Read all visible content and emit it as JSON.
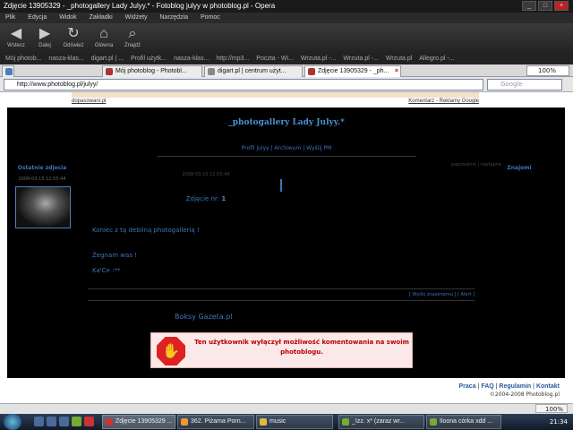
{
  "window": {
    "title": "Zdjęcie 13905329 - _photogallery Lady Julyy.* - Fotoblog julyy w photoblog.pl - Opera"
  },
  "menu": [
    "Plik",
    "Edycja",
    "Widok",
    "Zakładki",
    "Widżety",
    "Narzędzia",
    "Pomoc"
  ],
  "toolbar": {
    "back": "Wstecz",
    "forward": "Dalej",
    "reload": "Odśwież",
    "home": "Główna",
    "find": "Znajdź"
  },
  "bookmarks": [
    "Mój photob...",
    "nasza-klas...",
    "digart.pl | ...",
    "Profil użytk...",
    "nasza-klas...",
    "http://mp3...",
    "Poczta - Wi...",
    "Wrzuta.pl -...",
    "Wrzuta.pl -...",
    "Wrzuta.pl",
    "Allegro.pl -..."
  ],
  "tabs": [
    {
      "label": "Mój photoblog - Photobl..."
    },
    {
      "label": "digart.pl | centrum użyt..."
    },
    {
      "label": "Zdjęcie 13905329 - _ph..."
    }
  ],
  "zoom_top": "100%",
  "address": "http://www.photoblog.pl/julyy/",
  "search_placeholder": "Google",
  "page": {
    "ad_left": "dopasowani.pl",
    "ad_right": "Komentarz - Reklamy Google",
    "blog_title": "_photogallery Lady Julyy.*",
    "profile_nav": "Profil julyy | Archiwum | Wyślij PM",
    "sidebar_title": "Ostatnie zdjecia",
    "sidebar_date": "2008-03-15 12:55:44",
    "friends_title": "Znajomi",
    "prev_next": "poprzednie | następne",
    "post_date": "2008-03-15 12:55:44",
    "photo_number_label": "Zdjęcie nr:",
    "photo_number": "1",
    "post_lines": [
      "Koniec z tą debilną photogallerią !",
      "Żegnam was !",
      "Ka'Ce :**"
    ],
    "share_links": "[ Wyślij znajomemu ] [ Alert ]",
    "boksy": "Boksy Gazeta.pl",
    "notice": "Ten użytkownik wyłączył możliwość komentowania na swoim photoblogu.",
    "footer_links": [
      "Praca",
      "FAQ",
      "Regulamin",
      "Kontakt"
    ],
    "copyright": "©2004-2008 Photoblog.pl"
  },
  "zoom_bottom": "100%",
  "taskbar": {
    "tasks": [
      "Zdjęcie 13905329 ...",
      "362. Piżama Porn...",
      "music",
      "_Izz. x* (zaraz wr...",
      "Iloona córka xdd ..."
    ],
    "clock": "21:34"
  }
}
